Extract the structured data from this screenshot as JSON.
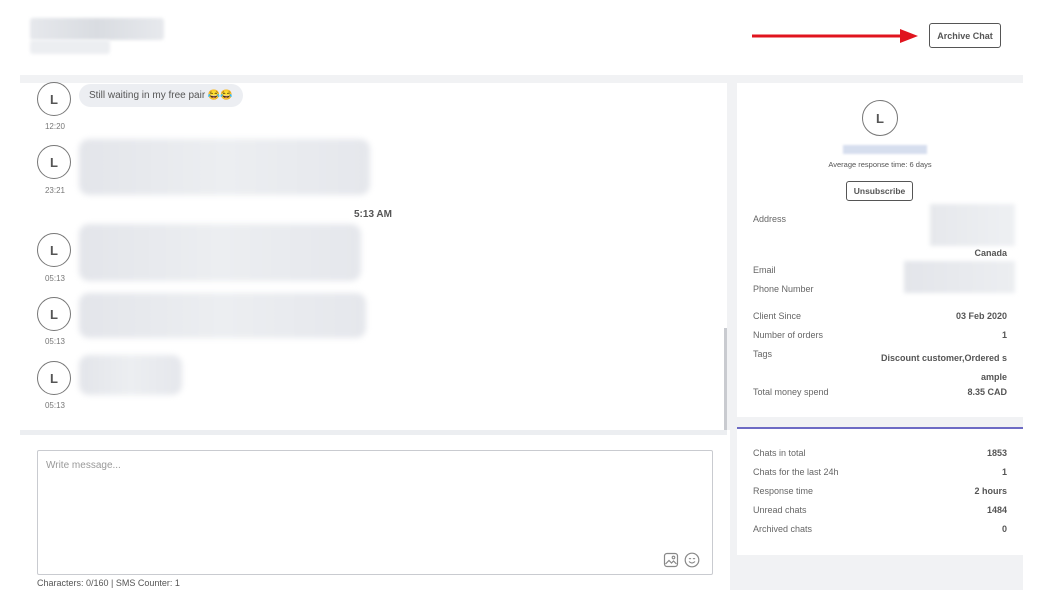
{
  "header": {
    "archive_label": "Archive Chat"
  },
  "chat": {
    "messages": [
      {
        "avatar": "L",
        "text": "Still waiting in my free pair 😂😂",
        "time": "12:20"
      },
      {
        "avatar": "L",
        "time": "23:21"
      },
      {
        "avatar": "L",
        "time": "05:13"
      },
      {
        "avatar": "L",
        "time": "05:13"
      },
      {
        "avatar": "L",
        "time": "05:13"
      }
    ],
    "day_separator": "5:13 AM"
  },
  "composer": {
    "placeholder": "Write message...",
    "counter": "Characters: 0/160 | SMS Counter: 1"
  },
  "profile": {
    "avatar": "L",
    "response_time": "Average response time: 6 days",
    "unsubscribe_label": "Unsubscribe",
    "address_label": "Address",
    "address_country": "Canada",
    "email_label": "Email",
    "phone_label": "Phone Number",
    "client_since_label": "Client Since",
    "client_since": "03 Feb 2020",
    "orders_label": "Number of orders",
    "orders": "1",
    "tags_label": "Tags",
    "tags": "Discount customer,Ordered sample",
    "money_label": "Total money spend",
    "money": "8.35 CAD"
  },
  "stats": {
    "chats_total_label": "Chats in total",
    "chats_total": "1853",
    "chats_24h_label": "Chats for the last 24h",
    "chats_24h": "1",
    "response_time_label": "Response time",
    "response_time": "2 hours",
    "unread_label": "Unread chats",
    "unread": "1484",
    "archived_label": "Archived chats",
    "archived": "0"
  },
  "colors": {
    "accent": "#6d6bc4",
    "arrow": "#e0141e"
  },
  "icons": [
    "image-icon",
    "emoji-icon"
  ]
}
